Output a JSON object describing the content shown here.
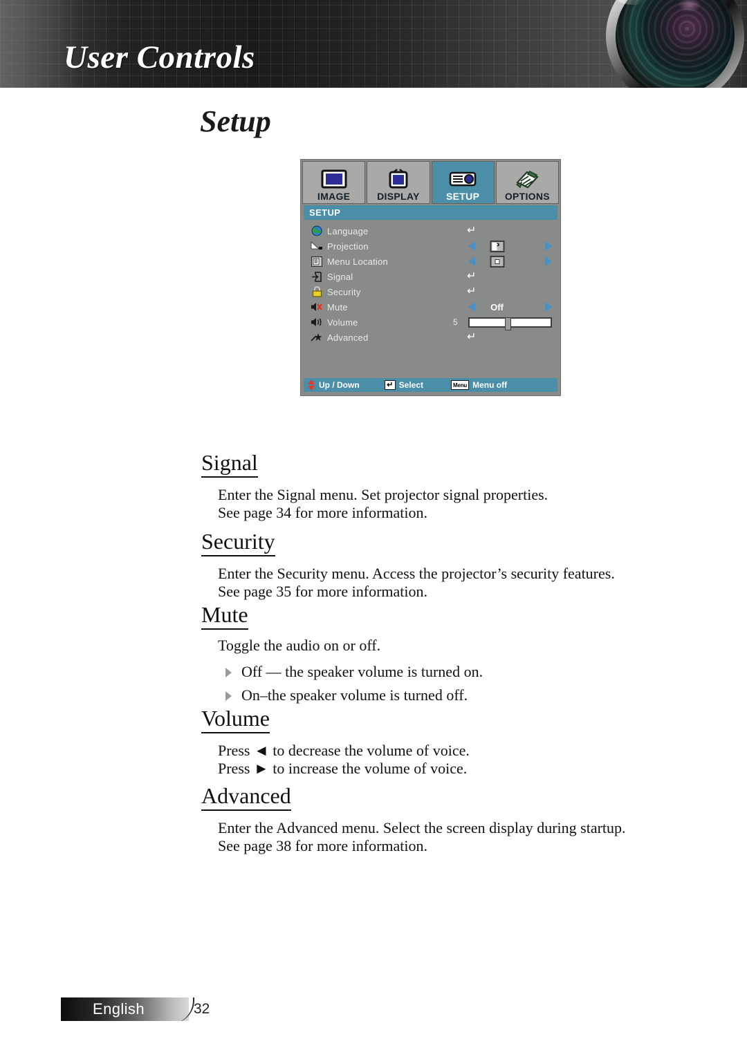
{
  "header": {
    "title": "User Controls",
    "lens_icon": "camera-lens-image"
  },
  "page_title": "Setup",
  "osd": {
    "tabs": [
      {
        "label": "IMAGE",
        "icon": "monitor-icon",
        "active": false
      },
      {
        "label": "DISPLAY",
        "icon": "television-icon",
        "active": false
      },
      {
        "label": "SETUP",
        "icon": "projector-icon",
        "active": true
      },
      {
        "label": "OPTIONS",
        "icon": "notepad-pen-icon",
        "active": false
      }
    ],
    "section_title": "SETUP",
    "items": [
      {
        "label": "Language",
        "icon": "globe-icon",
        "control": "enter"
      },
      {
        "label": "Projection",
        "icon": "projection-ramp-icon",
        "control": "arrows",
        "value": "P"
      },
      {
        "label": "Menu Location",
        "icon": "document-icon",
        "control": "arrows",
        "value": "square"
      },
      {
        "label": "Signal",
        "icon": "signal-input-icon",
        "control": "enter"
      },
      {
        "label": "Security",
        "icon": "padlock-icon",
        "control": "enter"
      },
      {
        "label": "Mute",
        "icon": "speaker-mute-icon",
        "control": "arrows",
        "value": "Off"
      },
      {
        "label": "Volume",
        "icon": "speaker-icon",
        "control": "slider",
        "value": "5"
      },
      {
        "label": "Advanced",
        "icon": "star-wand-icon",
        "control": "enter"
      }
    ],
    "footer": {
      "updown_label": "Up / Down",
      "select_key": "↵",
      "select_label": "Select",
      "menu_key": "Menu",
      "menu_label": "Menu off"
    },
    "colors": {
      "highlight": "#4a8ea8",
      "panel": "#888b88",
      "tab": "#a9aaa8"
    }
  },
  "sections": [
    {
      "heading": "Signal",
      "lines": [
        "Enter the Signal menu. Set projector signal properties.",
        "See page 34 for more information."
      ]
    },
    {
      "heading": "Security",
      "lines": [
        "Enter the Security menu. Access the projector’s security features.",
        "See page 35 for more information."
      ]
    },
    {
      "heading": "Mute",
      "lines": [
        "Toggle the audio on or off."
      ],
      "bullets": [
        "Off — the speaker volume is turned on.",
        "On–the speaker volume is turned off."
      ]
    },
    {
      "heading": "Volume",
      "lines": [
        "Press ◄ to decrease the volume of voice.",
        "Press ► to increase the volume of voice."
      ]
    },
    {
      "heading": "Advanced",
      "lines": [
        "Enter the Advanced menu. Select the screen display during startup.",
        "See  page 38 for more information."
      ]
    }
  ],
  "footer": {
    "language": "English",
    "page_number": "32"
  }
}
